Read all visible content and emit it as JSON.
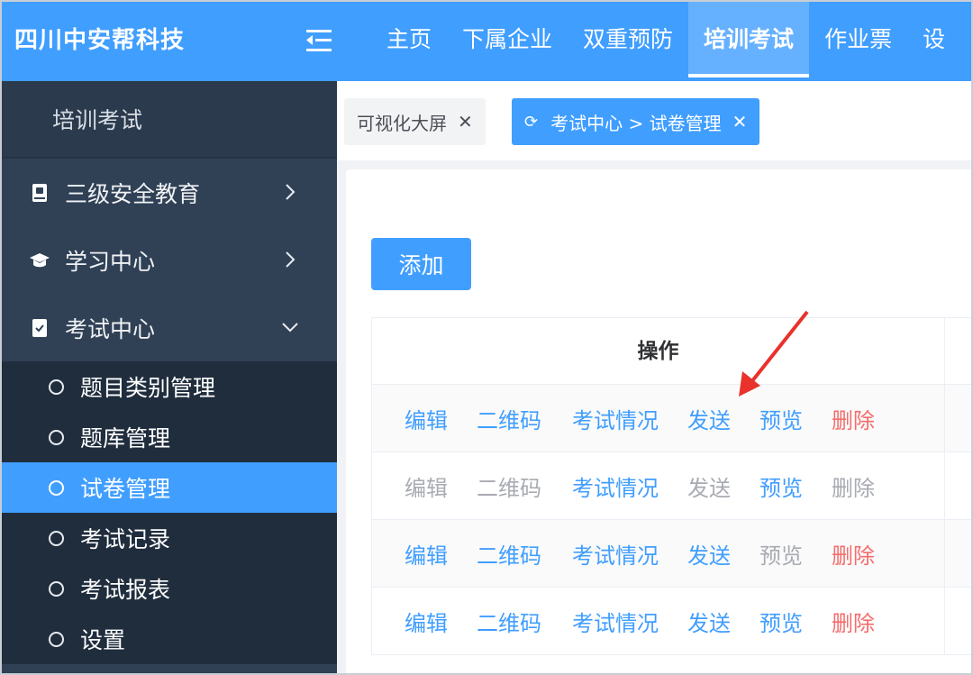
{
  "brand": "四川中安帮科技",
  "nav": [
    {
      "label": "主页"
    },
    {
      "label": "下属企业"
    },
    {
      "label": "双重预防"
    },
    {
      "label": "培训考试",
      "active": true
    },
    {
      "label": "作业票"
    },
    {
      "label": "设"
    }
  ],
  "sidebar": {
    "title": "培训考试",
    "groups": [
      {
        "label": "三级安全教育",
        "icon": "book-icon",
        "expanded": false
      },
      {
        "label": "学习中心",
        "icon": "graduation-cap-icon",
        "expanded": false
      },
      {
        "label": "考试中心",
        "icon": "exam-icon",
        "expanded": true
      }
    ],
    "sub_items": [
      {
        "label": "题目类别管理"
      },
      {
        "label": "题库管理"
      },
      {
        "label": "试卷管理",
        "active": true
      },
      {
        "label": "考试记录"
      },
      {
        "label": "考试报表"
      },
      {
        "label": "设置"
      }
    ]
  },
  "tabs": [
    {
      "label": "可视化大屏"
    },
    {
      "label": "考试中心 > 试卷管理",
      "active": true
    }
  ],
  "toolbar": {
    "add_label": "添加"
  },
  "table": {
    "header": "操作",
    "rows": [
      [
        {
          "label": "编辑",
          "state": "enabled"
        },
        {
          "label": "二维码",
          "state": "enabled"
        },
        {
          "label": "考试情况",
          "state": "enabled"
        },
        {
          "label": "发送",
          "state": "enabled"
        },
        {
          "label": "预览",
          "state": "enabled"
        },
        {
          "label": "删除",
          "state": "danger"
        }
      ],
      [
        {
          "label": "编辑",
          "state": "disabled"
        },
        {
          "label": "二维码",
          "state": "disabled"
        },
        {
          "label": "考试情况",
          "state": "enabled"
        },
        {
          "label": "发送",
          "state": "disabled"
        },
        {
          "label": "预览",
          "state": "enabled"
        },
        {
          "label": "删除",
          "state": "disabled"
        }
      ],
      [
        {
          "label": "编辑",
          "state": "enabled"
        },
        {
          "label": "二维码",
          "state": "enabled"
        },
        {
          "label": "考试情况",
          "state": "enabled"
        },
        {
          "label": "发送",
          "state": "enabled"
        },
        {
          "label": "预览",
          "state": "disabled"
        },
        {
          "label": "删除",
          "state": "danger"
        }
      ],
      [
        {
          "label": "编辑",
          "state": "enabled"
        },
        {
          "label": "二维码",
          "state": "enabled"
        },
        {
          "label": "考试情况",
          "state": "enabled"
        },
        {
          "label": "发送",
          "state": "enabled"
        },
        {
          "label": "预览",
          "state": "enabled"
        },
        {
          "label": "删除",
          "state": "danger"
        }
      ]
    ]
  },
  "colors": {
    "primary": "#409eff",
    "danger": "#f56c6c",
    "disabled": "#a8abb2",
    "sidebar_bg": "#304156",
    "annotation_arrow": "#e8322b"
  }
}
